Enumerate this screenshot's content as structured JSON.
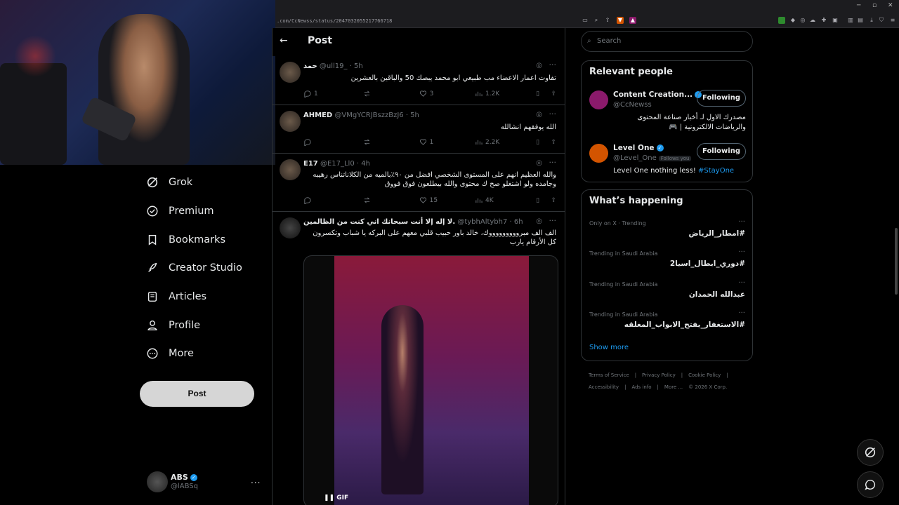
{
  "browser": {
    "url": ".com/CcNewss/status/2047032055217766718"
  },
  "header": {
    "back_label": "←",
    "title": "Post"
  },
  "nav": {
    "items": [
      {
        "label": "Grok",
        "icon": "grok-icon"
      },
      {
        "label": "Premium",
        "icon": "verified-icon"
      },
      {
        "label": "Bookmarks",
        "icon": "bookmark-icon"
      },
      {
        "label": "Creator Studio",
        "icon": "rocket-icon"
      },
      {
        "label": "Articles",
        "icon": "article-icon"
      },
      {
        "label": "Profile",
        "icon": "person-icon"
      },
      {
        "label": "More",
        "icon": "more-circle-icon"
      }
    ],
    "post_button": "Post"
  },
  "account": {
    "name": "ABS",
    "handle": "@lABSq",
    "more": "..."
  },
  "tweets": [
    {
      "name": "حمد",
      "handle": "@ull19_",
      "time": "· 5h",
      "body": "تفاوت اعمار الاعضاء مب طبيعي ابو محمد يبصك 50 والباقين بالعشرين",
      "replies": "1",
      "reposts": "",
      "likes": "3",
      "views": "1.2K"
    },
    {
      "name": "AHMED",
      "handle": "@VMgYCRJBszzBzJ6",
      "time": "· 5h",
      "body": "الله يوفقهم انشالله",
      "replies": "",
      "reposts": "",
      "likes": "1",
      "views": "2.2K"
    },
    {
      "name": "E17",
      "handle": "@E17_Ll0",
      "time": "· 4h",
      "body": "والله العظيم انهم على المستوى الشخصي افضل من ٩٠٪بالميه من الكلاناتناس رهيبه وجامده ولو اشتغلو صح ك محتوى والله بيطلعون فوق فووق",
      "replies": "",
      "reposts": "",
      "likes": "15",
      "views": "4K"
    },
    {
      "name": "لا إله إلا أنت سبحانك اني كنت من الظالمين.",
      "handle": "@tybhAltybh7",
      "time": "· 6h",
      "body": "الف الف مبروووووووووك، خالد باور حبيب قلبي معهم على البركه يا شباب وتكسرون كل الأرقام يارب",
      "media_label": "GIF"
    }
  ],
  "search": {
    "placeholder": "Search"
  },
  "relevant_people": {
    "title": "Relevant people",
    "people": [
      {
        "name": "Content Creation...",
        "handle": "@CcNewss",
        "button": "Following",
        "bio": "مصدرك الاول لـ أخبار صناعة المحتوى والرياضات الالكترونية | 🎮",
        "avatar_color": "#8b1a6b"
      },
      {
        "name": "Level One",
        "handle": "@Level_One",
        "follows_you": "Follows you",
        "button": "Following",
        "bio": "Level One nothing less!",
        "bio_link": "#StayOne",
        "avatar_color": "#d35400"
      }
    ]
  },
  "whats_happening": {
    "title": "What’s happening",
    "trends": [
      {
        "context": "Only on X · Trending",
        "name": "#امطار_الرياض"
      },
      {
        "context": "Trending in Saudi Arabia",
        "name": "#دوري_ابطال_اسيا2"
      },
      {
        "context": "Trending in Saudi Arabia",
        "name": "عبدالله الحمدان"
      },
      {
        "context": "Trending in Saudi Arabia",
        "name": "#الاستغفار_يفتح_الابواب_المغلقه"
      }
    ],
    "show_more": "Show more"
  },
  "footer": {
    "links": [
      "Terms of Service",
      "|",
      "Privacy Policy",
      "|",
      "Cookie Policy",
      "|",
      "Accessibility",
      "|",
      "Ads info",
      "|",
      "More ...",
      "© 2026 X Corp."
    ]
  }
}
